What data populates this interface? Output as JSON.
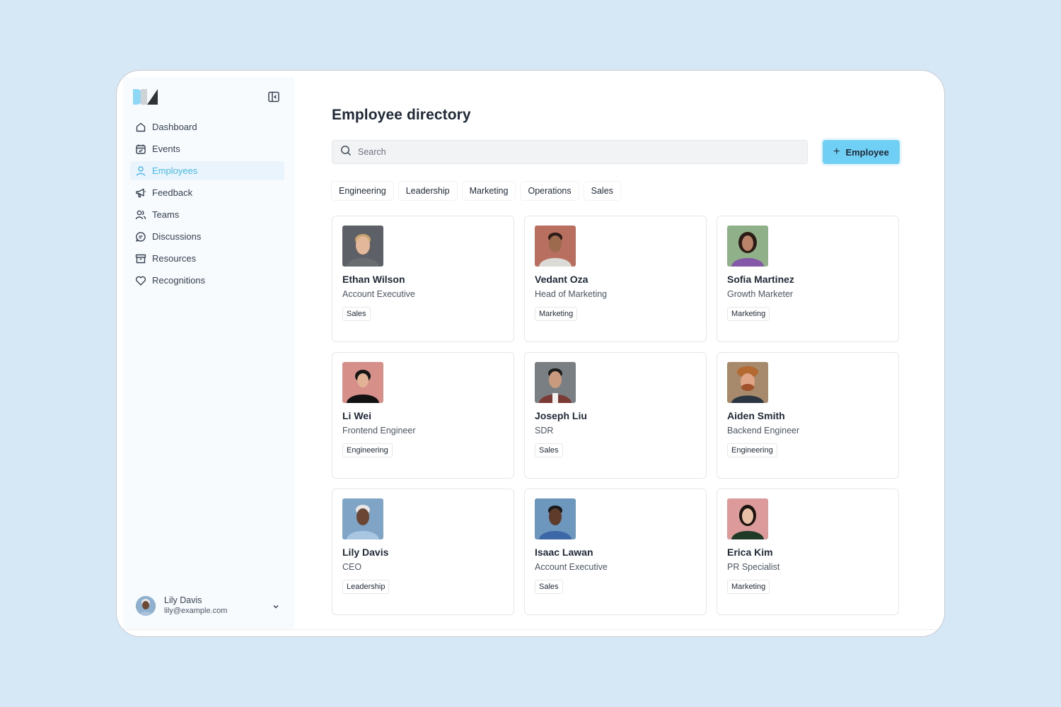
{
  "sidebar": {
    "items": [
      {
        "label": "Dashboard",
        "icon": "home-icon"
      },
      {
        "label": "Events",
        "icon": "calendar-icon"
      },
      {
        "label": "Employees",
        "icon": "user-icon",
        "active": true
      },
      {
        "label": "Feedback",
        "icon": "megaphone-icon"
      },
      {
        "label": "Teams",
        "icon": "users-icon"
      },
      {
        "label": "Discussions",
        "icon": "chat-icon"
      },
      {
        "label": "Resources",
        "icon": "archive-icon"
      },
      {
        "label": "Recognitions",
        "icon": "heart-icon"
      }
    ],
    "user": {
      "name": "Lily Davis",
      "email": "lily@example.com"
    }
  },
  "main": {
    "title": "Employee directory",
    "search_placeholder": "Search",
    "add_button_label": "Employee",
    "filters": [
      "Engineering",
      "Leadership",
      "Marketing",
      "Operations",
      "Sales"
    ],
    "employees": [
      {
        "name": "Ethan Wilson",
        "role": "Account Executive",
        "department": "Sales"
      },
      {
        "name": "Vedant Oza",
        "role": "Head of Marketing",
        "department": "Marketing"
      },
      {
        "name": "Sofia Martinez",
        "role": "Growth Marketer",
        "department": "Marketing"
      },
      {
        "name": "Li Wei",
        "role": "Frontend Engineer",
        "department": "Engineering"
      },
      {
        "name": "Joseph Liu",
        "role": "SDR",
        "department": "Sales"
      },
      {
        "name": "Aiden Smith",
        "role": "Backend Engineer",
        "department": "Engineering"
      },
      {
        "name": "Lily Davis",
        "role": "CEO",
        "department": "Leadership"
      },
      {
        "name": "Isaac Lawan",
        "role": "Account Executive",
        "department": "Sales"
      },
      {
        "name": "Erica Kim",
        "role": "PR Specialist",
        "department": "Marketing"
      }
    ]
  },
  "colors": {
    "accent": "#48b8ea",
    "button": "#70cff5",
    "page_background": "#d6e7f5",
    "sidebar_background": "#f7fbfe"
  }
}
